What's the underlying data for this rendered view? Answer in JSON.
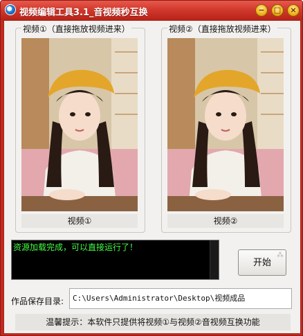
{
  "window": {
    "title": "视频编辑工具3.1_音视频秒互换"
  },
  "video1": {
    "group_title": "视频①（直接拖放视频进来）",
    "caption": "视频①"
  },
  "video2": {
    "group_title": "视频②（直接拖放视频进来）",
    "caption": "视频②"
  },
  "log": {
    "text": "资源加载完成，可以直接运行了！"
  },
  "buttons": {
    "start": "开始",
    "minimize": "−",
    "maximize": "□",
    "close": "×"
  },
  "save": {
    "label": "作品保存目录:",
    "path": "C:\\Users\\Administrator\\Desktop\\视频成品"
  },
  "tip": {
    "text": "温馨提示：本软件只提供将视频①与视频②音视频互换功能"
  },
  "colors": {
    "titlebar": "#c42a1f",
    "log_bg": "#000000",
    "log_text": "#44ff44",
    "window_bg": "#f2f1ef"
  }
}
